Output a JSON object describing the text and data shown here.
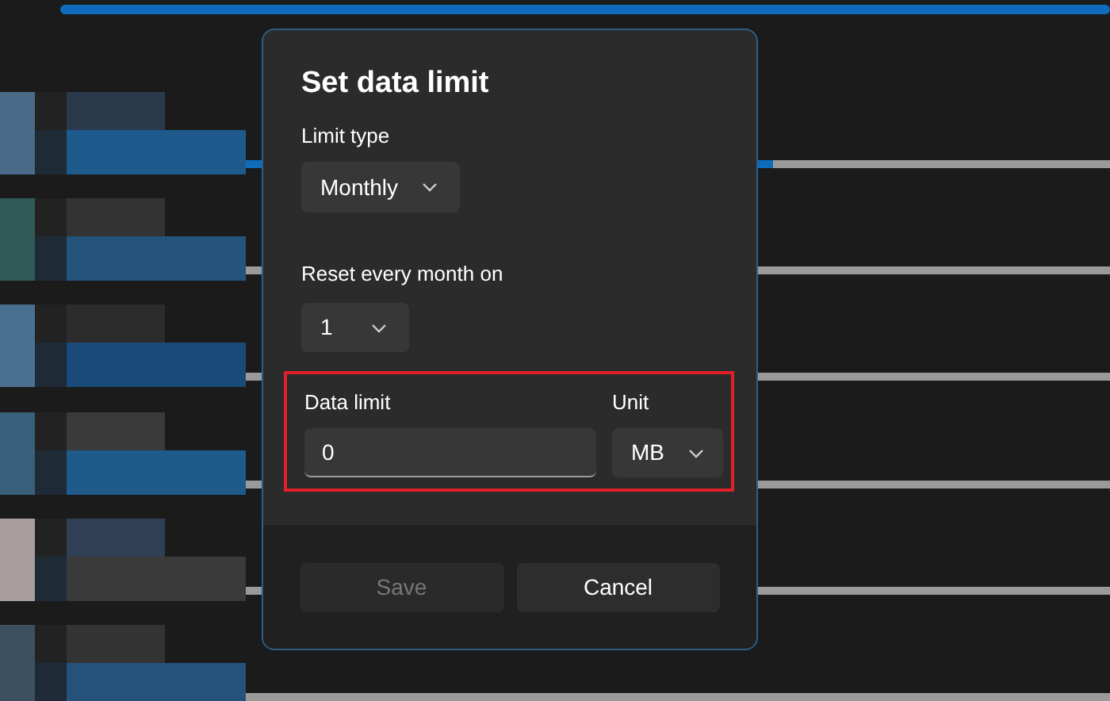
{
  "top_bar": {
    "level": 1
  },
  "dialog": {
    "title": "Set data limit",
    "limit_type": {
      "label": "Limit type",
      "value": "Monthly"
    },
    "reset_day": {
      "label": "Reset every month on",
      "value": "1"
    },
    "limit_group": {
      "highlighted": true,
      "data_limit": {
        "label": "Data limit",
        "value": "0"
      },
      "unit": {
        "label": "Unit",
        "value": "MB"
      }
    },
    "buttons": [
      {
        "label": "Save",
        "disabled": true
      },
      {
        "label": "Cancel",
        "disabled": false
      }
    ]
  }
}
